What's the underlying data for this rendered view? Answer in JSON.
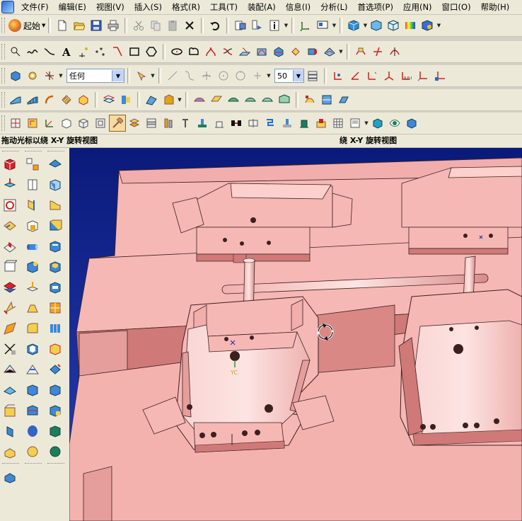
{
  "menubar": {
    "items": [
      "文件(F)",
      "编辑(E)",
      "视图(V)",
      "插入(S)",
      "格式(R)",
      "工具(T)",
      "装配(A)",
      "信息(I)",
      "分析(L)",
      "首选项(P)",
      "应用(N)",
      "窗口(O)",
      "帮助(H)"
    ]
  },
  "toolbar": {
    "start_label": "起始",
    "filter_value": "任何",
    "snap_value": "50"
  },
  "status": {
    "left": "拖动光标以绕 X-Y 旋转视图",
    "right": "绕 X-Y 旋转视图"
  },
  "viewport": {
    "wcs_label": "YC"
  },
  "colors": {
    "part_face": "#f6b8b5",
    "part_face_dark": "#e59e9c",
    "part_face_side": "#cf7a78",
    "part_edge": "#3b2020",
    "background": "#000080"
  }
}
